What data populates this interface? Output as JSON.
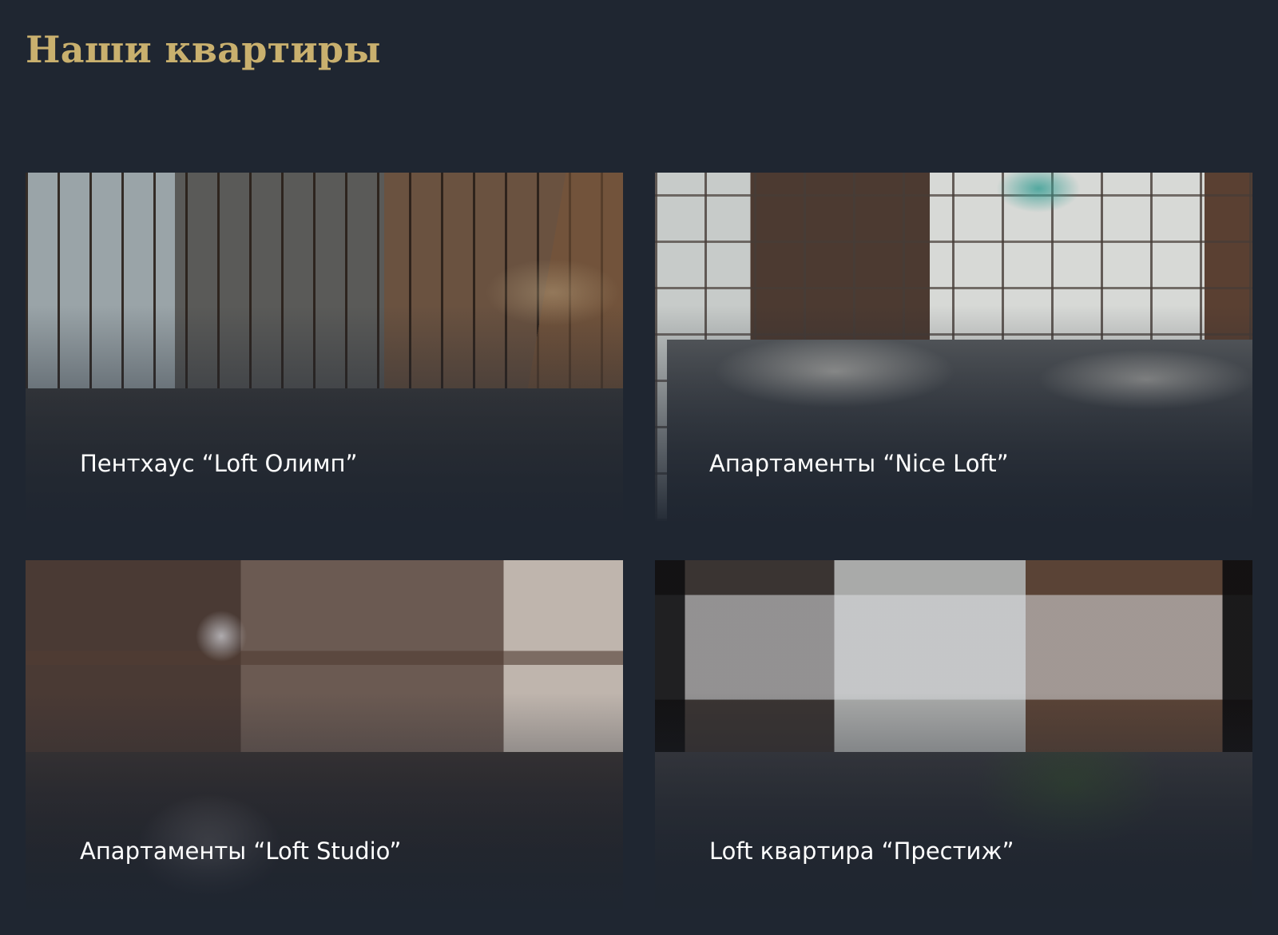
{
  "section": {
    "title": "Наши квартиры"
  },
  "apartments": [
    {
      "name": "Пентхаус “Loft Олимп”"
    },
    {
      "name": "Апартаменты “Nice Loft”"
    },
    {
      "name": "Апартаменты “Loft Studio”"
    },
    {
      "name": "Loft квартира “Престиж”"
    }
  ],
  "colors": {
    "background": "#1f2631",
    "title_accent": "#c9b06e",
    "caption_text": "#ffffff"
  }
}
